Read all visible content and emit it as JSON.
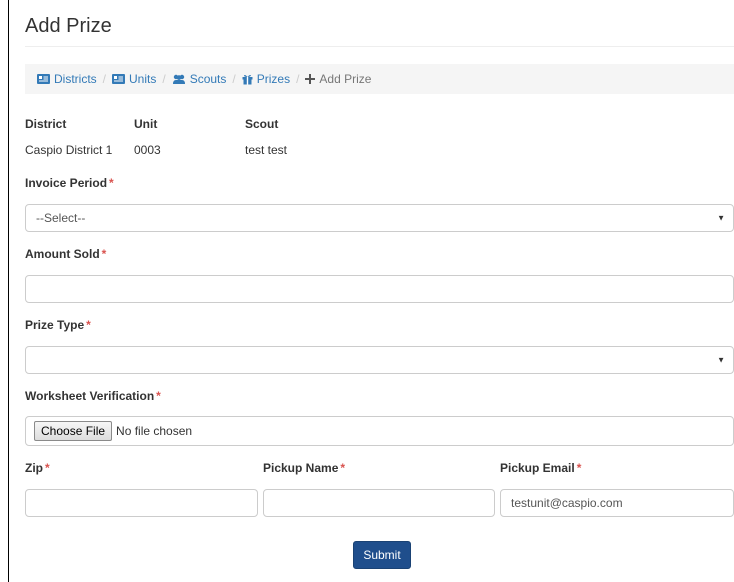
{
  "page": {
    "title": "Add Prize"
  },
  "breadcrumb": {
    "items": [
      {
        "label": "Districts",
        "icon": "id-card-icon"
      },
      {
        "label": "Units",
        "icon": "id-card-icon"
      },
      {
        "label": "Scouts",
        "icon": "users-icon"
      },
      {
        "label": "Prizes",
        "icon": "gift-icon"
      },
      {
        "label": "Add Prize",
        "icon": "plus-icon"
      }
    ],
    "separator": "/"
  },
  "info": {
    "district": {
      "label": "District",
      "value": "Caspio District 1"
    },
    "unit": {
      "label": "Unit",
      "value": "0003"
    },
    "scout": {
      "label": "Scout",
      "value": "test test"
    }
  },
  "form": {
    "required_marker": "*",
    "invoice_period": {
      "label": "Invoice Period",
      "selected": "--Select--"
    },
    "amount_sold": {
      "label": "Amount Sold",
      "value": ""
    },
    "prize_type": {
      "label": "Prize Type",
      "selected": ""
    },
    "worksheet": {
      "label": "Worksheet Verification",
      "button": "Choose File",
      "status": "No file chosen"
    },
    "zip": {
      "label": "Zip",
      "value": ""
    },
    "pickup_name": {
      "label": "Pickup Name",
      "value": ""
    },
    "pickup_email": {
      "label": "Pickup Email",
      "value": "testunit@caspio.com"
    },
    "submit_label": "Submit"
  },
  "colors": {
    "link": "#337ab7",
    "required": "#d9534f",
    "submit_bg": "#1f4e8c",
    "breadcrumb_bg": "#f5f5f5"
  }
}
